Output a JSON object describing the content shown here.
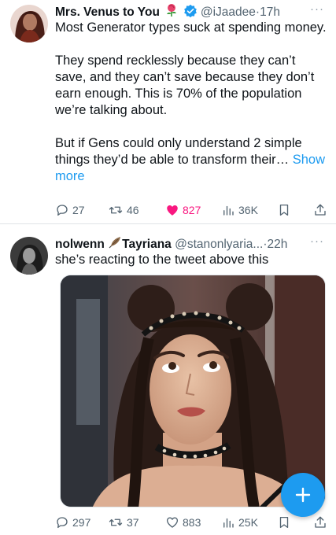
{
  "tweets": [
    {
      "display_name": "Mrs. Venus to You",
      "handle": "@iJaadee",
      "separator": "·",
      "time": "17h",
      "text_lines": [
        "Most Generator types suck at spending money.",
        "They spend recklessly because they can’t save, and they can’t save because they don’t earn enough. This is 70% of the population we’re talking about.",
        "But if Gens could only understand 2 simple things they’d be able to transform their…"
      ],
      "show_more": "Show more",
      "replies": "27",
      "retweets": "46",
      "likes": "827",
      "views": "36K",
      "liked": true,
      "badges": [
        "rose-emoji",
        "verified-badge"
      ]
    },
    {
      "display_name": "nolwenn",
      "display_name_suffix": "Tayriana",
      "handle": "@stanonlyaria...",
      "separator": "·",
      "time": "22h",
      "text": "she’s reacting to the tweet above this",
      "replies": "297",
      "retweets": "37",
      "likes": "883",
      "views": "25K",
      "liked": false,
      "badges": [
        "feather-emoji"
      ]
    }
  ],
  "colors": {
    "accent": "#1d9bf0",
    "like": "#f91880",
    "secondary_text": "#536471",
    "verified": "#1d9bf0"
  },
  "compose_button": {
    "icon": "plus-icon"
  }
}
